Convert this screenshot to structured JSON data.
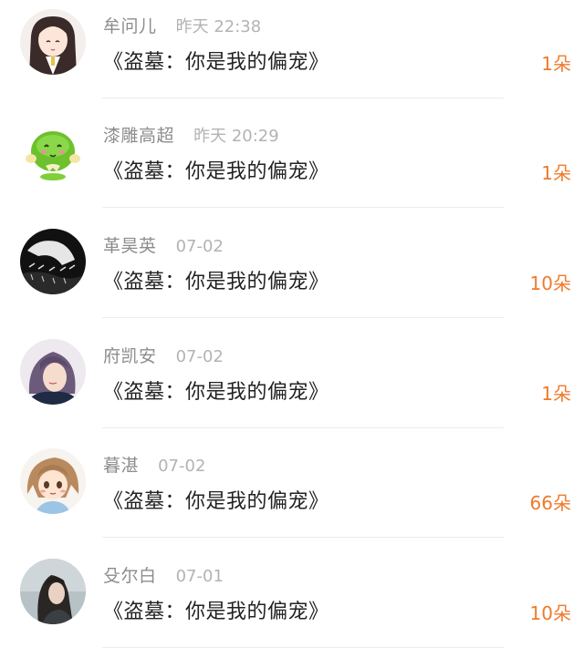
{
  "rows": [
    {
      "user": "牟问儿",
      "time": "昨天 22:38",
      "title": "《盗墓：你是我的偏宠》",
      "count": "1朵",
      "avatar": "anime-girl-avatar"
    },
    {
      "user": "漆雕高超",
      "time": "昨天 20:29",
      "title": "《盗墓：你是我的偏宠》",
      "count": "1朵",
      "avatar": "green-blob-avatar"
    },
    {
      "user": "革昊英",
      "time": "07-02",
      "title": "《盗墓：你是我的偏宠》",
      "count": "10朵",
      "avatar": "dark-text-avatar"
    },
    {
      "user": "府凯安",
      "time": "07-02",
      "title": "《盗墓：你是我的偏宠》",
      "count": "1朵",
      "avatar": "purple-hair-girl-avatar"
    },
    {
      "user": "暮湛",
      "time": "07-02",
      "title": "《盗墓：你是我的偏宠》",
      "count": "66朵",
      "avatar": "cartoon-girl-avatar"
    },
    {
      "user": "殳尔白",
      "time": "07-01",
      "title": "《盗墓：你是我的偏宠》",
      "count": "10朵",
      "avatar": "dark-hair-girl-avatar"
    }
  ],
  "colors": {
    "accent": "#f07a2b",
    "username": "#8c8c8c",
    "time": "#b3b3b3",
    "title": "#222222"
  }
}
